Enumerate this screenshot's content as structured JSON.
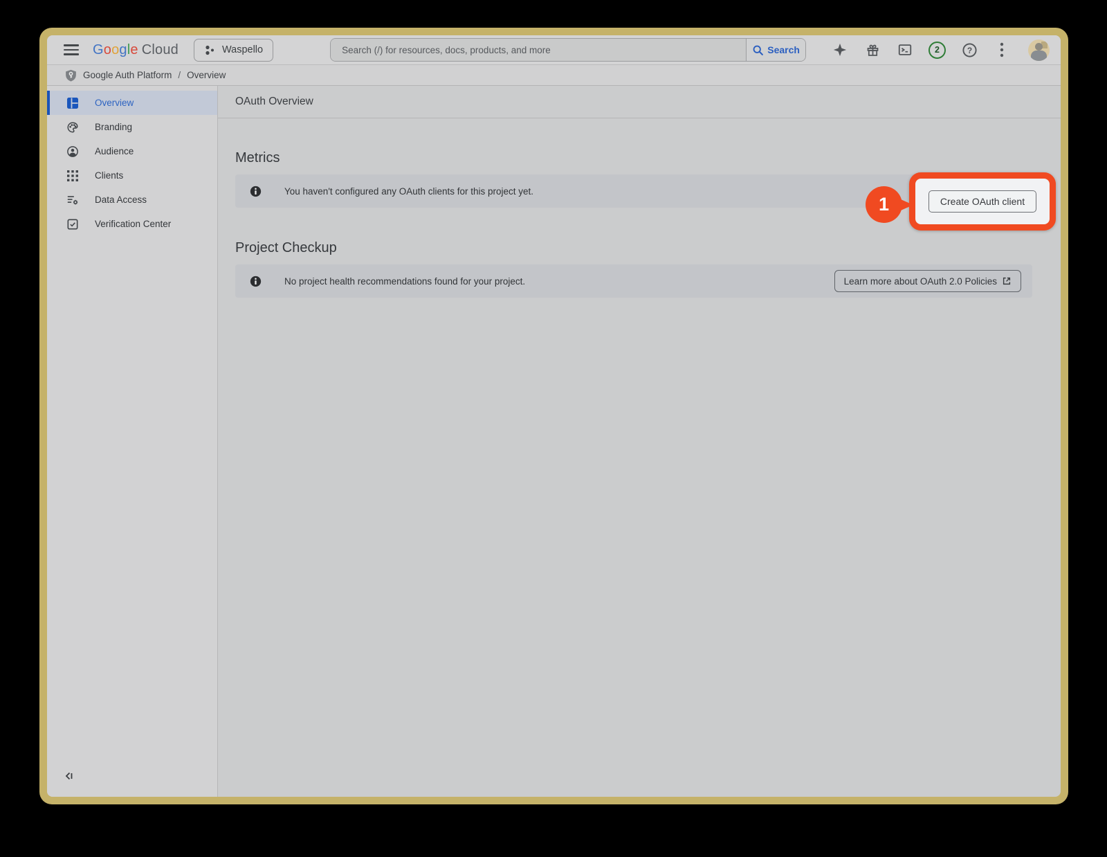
{
  "topbar": {
    "logo": {
      "letters": [
        "G",
        "o",
        "o",
        "g",
        "l",
        "e"
      ],
      "cloud": "Cloud"
    },
    "project_selector": "Waspello",
    "search": {
      "placeholder": "Search (/) for resources, docs, products, and more",
      "button_label": "Search"
    },
    "notification_count": "2"
  },
  "breadcrumb": {
    "root": "Google Auth Platform",
    "separator": "/",
    "current": "Overview"
  },
  "sidebar": {
    "items": [
      {
        "label": "Overview",
        "icon": "dashboard-icon",
        "selected": true
      },
      {
        "label": "Branding",
        "icon": "palette-icon",
        "selected": false
      },
      {
        "label": "Audience",
        "icon": "person-icon",
        "selected": false
      },
      {
        "label": "Clients",
        "icon": "apps-grid-icon",
        "selected": false
      },
      {
        "label": "Data Access",
        "icon": "list-settings-icon",
        "selected": false
      },
      {
        "label": "Verification Center",
        "icon": "check-box-icon",
        "selected": false
      }
    ]
  },
  "main": {
    "page_title": "OAuth Overview",
    "metrics": {
      "heading": "Metrics",
      "banner_text": "You haven't configured any OAuth clients for this project yet.",
      "create_button_label": "Create OAuth client"
    },
    "project_checkup": {
      "heading": "Project Checkup",
      "banner_text": "No project health recommendations found for your project.",
      "learn_more_label": "Learn more about OAuth 2.0 Policies"
    }
  },
  "annotation": {
    "step_number": "1",
    "color": "#f04a21"
  },
  "icons": {
    "hamburger-icon": "three horizontal bars",
    "search-icon": "magnifier",
    "gemini-sparkle-icon": "four-point star",
    "gift-icon": "gift box",
    "cloud-shell-icon": "terminal prompt >_",
    "help-icon": "question mark in circle",
    "more-vert-icon": "vertical ellipsis",
    "shield-key-icon": "shield with key",
    "info-icon": "filled i in circle",
    "external-link-icon": "box with arrow",
    "collapse-sidebar-icon": "chevron-left with bar"
  },
  "colors": {
    "frame": "#c5b269",
    "page_bg": "#cbcccd",
    "banner_bg": "#c3c5c9",
    "accent_blue": "#2d63c1",
    "annotation_red": "#f04a21",
    "highlight_inner": "#f1f2f4"
  }
}
